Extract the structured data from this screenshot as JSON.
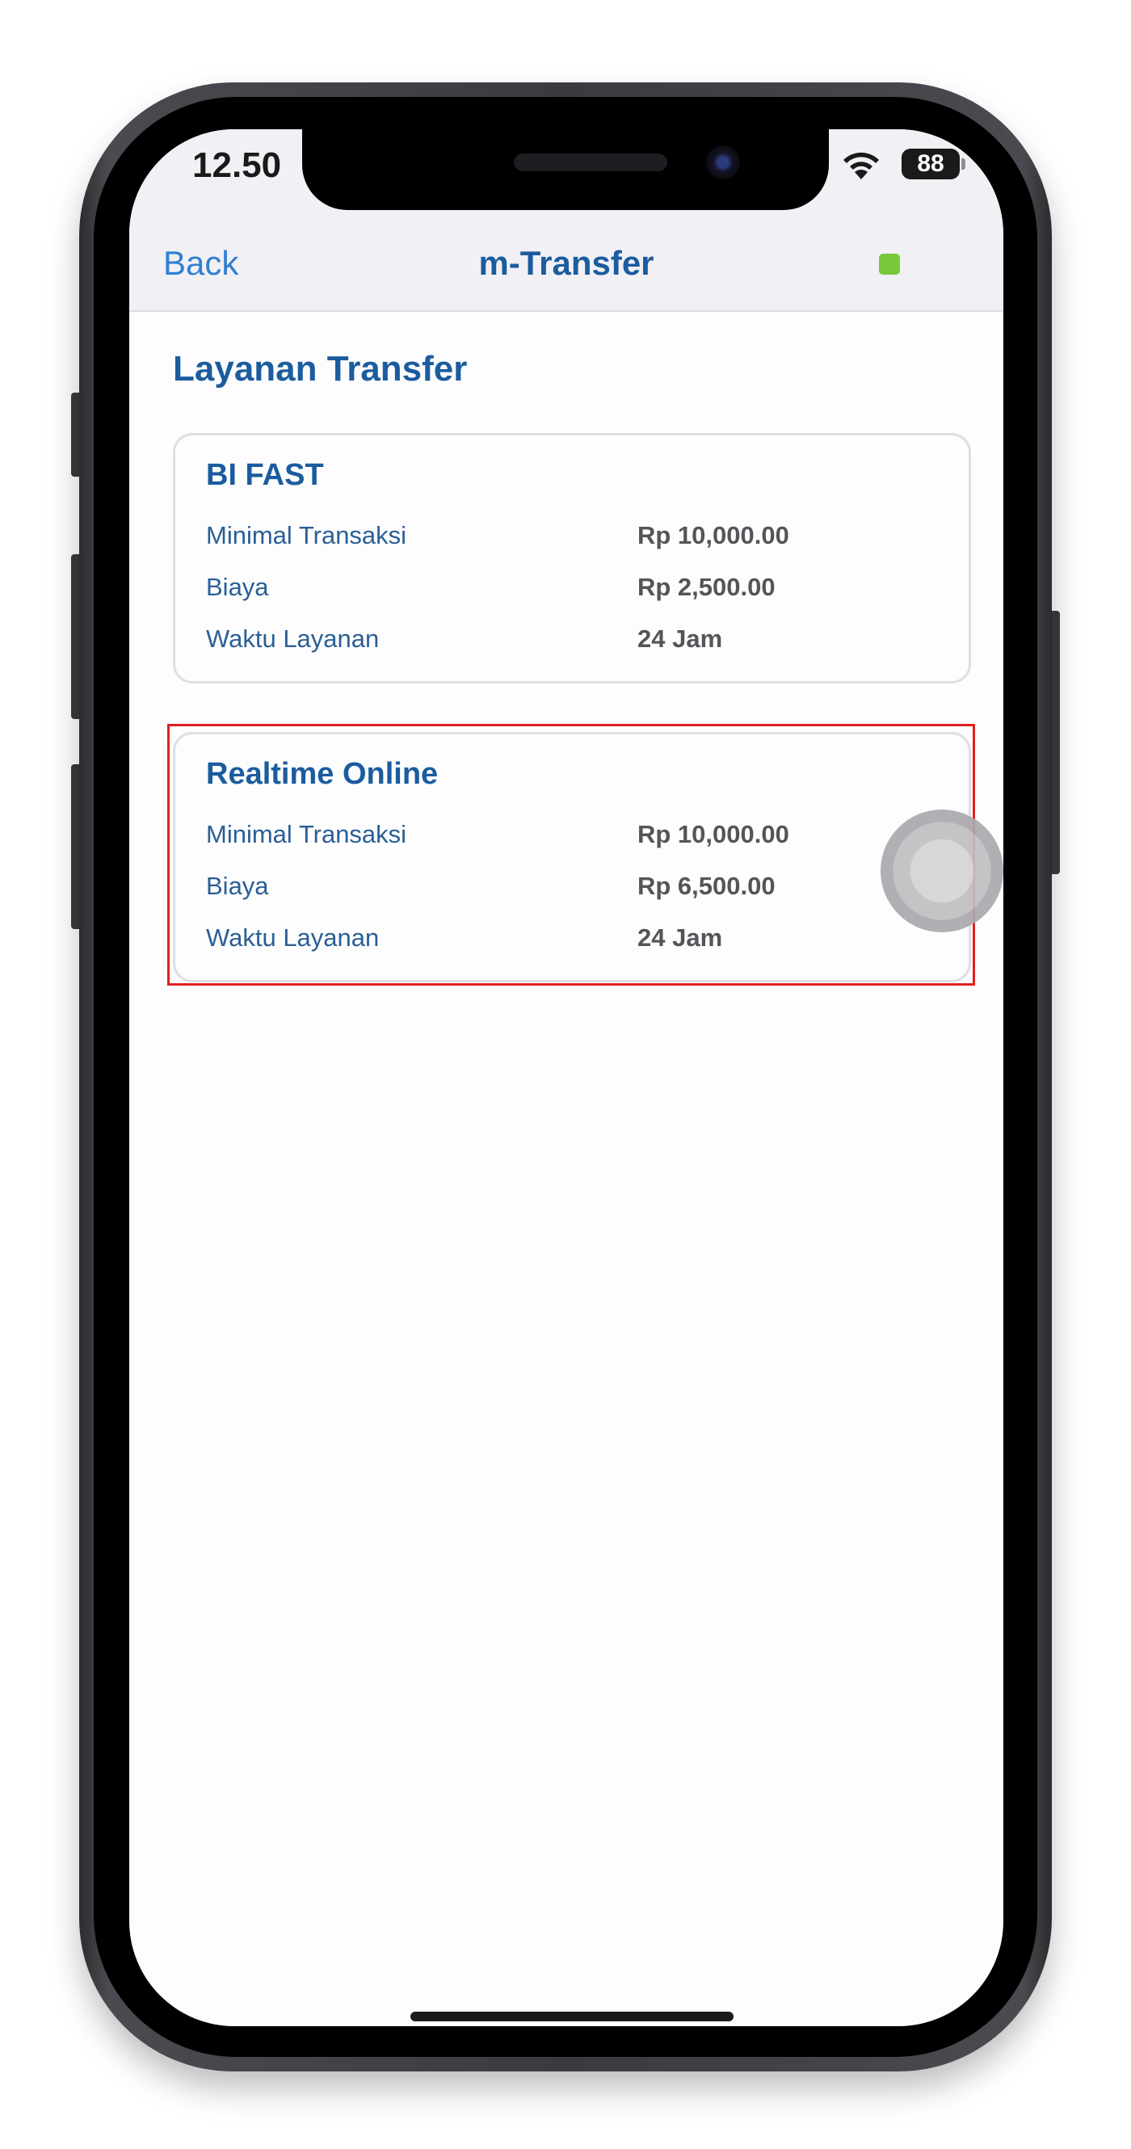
{
  "status_bar": {
    "time": "12.50",
    "battery": "88"
  },
  "nav": {
    "back_label": "Back",
    "title": "m-Transfer"
  },
  "page": {
    "section_title": "Layanan Transfer"
  },
  "cards": [
    {
      "title": "BI FAST",
      "rows": [
        {
          "label": "Minimal Transaksi",
          "value": "Rp 10,000.00"
        },
        {
          "label": "Biaya",
          "value": "Rp 2,500.00"
        },
        {
          "label": "Waktu Layanan",
          "value": "24 Jam"
        }
      ]
    },
    {
      "title": "Realtime Online",
      "rows": [
        {
          "label": "Minimal Transaksi",
          "value": "Rp 10,000.00"
        },
        {
          "label": "Biaya",
          "value": "Rp 6,500.00"
        },
        {
          "label": "Waktu Layanan",
          "value": "24 Jam"
        }
      ]
    }
  ],
  "colors": {
    "accent_blue": "#1b5c9e",
    "link_blue": "#2f7fd1",
    "status_green": "#78c83a",
    "highlight_red": "#e02020"
  },
  "icons": {
    "wifi": "wifi-icon",
    "battery": "battery-icon"
  }
}
